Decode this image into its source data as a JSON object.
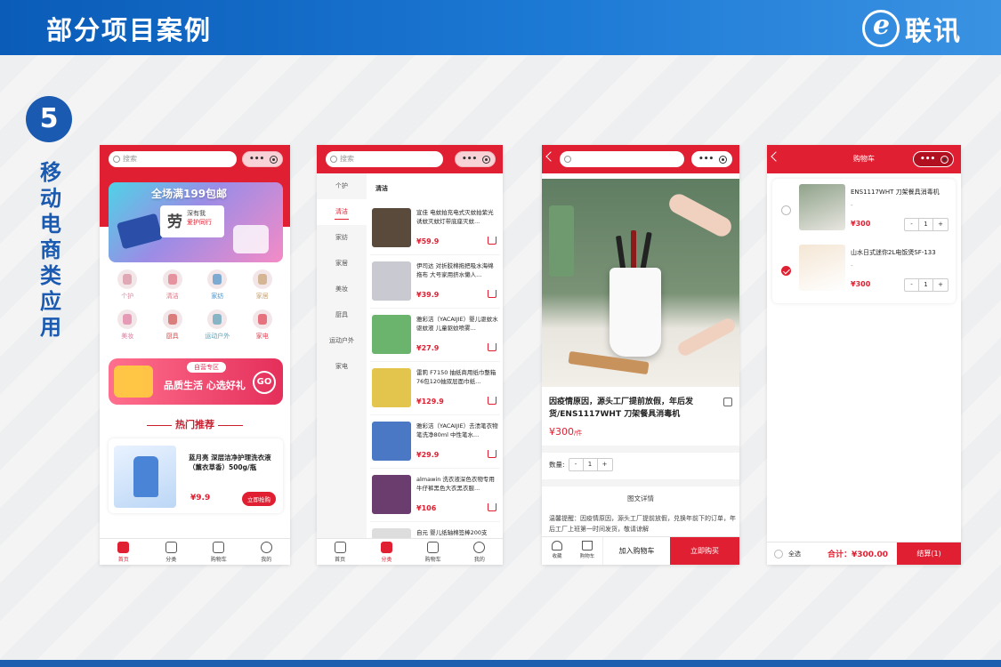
{
  "banner": {
    "title": "部分项目案例",
    "logo_text": "联讯"
  },
  "section": {
    "number": "5",
    "title": "移动电商类应用"
  },
  "colors": {
    "primary_red": "#e02032",
    "brand_blue": "#1a5ab0"
  },
  "phone1": {
    "search_placeholder": "搜索",
    "promo_top": "全场满199包邮",
    "promo_big": "劳",
    "promo_small1": "深有我",
    "promo_small2": "爱护同行",
    "categories": [
      {
        "label": "个护",
        "icon": "personal-care-icon"
      },
      {
        "label": "清洁",
        "icon": "cleaning-icon"
      },
      {
        "label": "家纺",
        "icon": "textile-icon"
      },
      {
        "label": "家居",
        "icon": "home-icon"
      },
      {
        "label": "美妆",
        "icon": "makeup-icon"
      },
      {
        "label": "厨具",
        "icon": "kitchen-icon"
      },
      {
        "label": "运动户外",
        "icon": "sports-icon"
      },
      {
        "label": "家电",
        "icon": "appliance-icon"
      }
    ],
    "promo2_tag": "自营专区",
    "promo2_main": "品质生活 心选好礼",
    "promo2_go": "GO",
    "hot_title": "热门推荐",
    "hot_item": {
      "name": "蓝月亮 深层洁净护理洗衣液（薰衣草香）500g/瓶",
      "price": "¥9.9",
      "button": "立即抢购"
    },
    "tabs": [
      {
        "label": "首页",
        "icon": "home-icon",
        "active": true
      },
      {
        "label": "分类",
        "icon": "category-icon",
        "active": false
      },
      {
        "label": "购物车",
        "icon": "cart-icon",
        "active": false
      },
      {
        "label": "我的",
        "icon": "user-icon",
        "active": false
      }
    ]
  },
  "phone2": {
    "search_placeholder": "搜索",
    "sidebar": [
      "个护",
      "清洁",
      "家纺",
      "家居",
      "美妆",
      "厨具",
      "运动户外",
      "家电"
    ],
    "active_side": "清洁",
    "section_title": "清洁",
    "products": [
      {
        "name": "宣佳 电蚊拍充电式灭蚊拍紫光诱蚊灭蚊灯带底座灭蚊...",
        "price": "¥59.9",
        "thumb_color": "#5a4a3c"
      },
      {
        "name": "伊司达 对折胶棉拖把吸水海绵拖布 大号家用挤水懒人...",
        "price": "¥39.9",
        "thumb_color": "#c9c9d2"
      },
      {
        "name": "雅彩洁（YACAIJIE）婴儿驱蚊水 驱蚊液 儿童驱蚊喷雾...",
        "price": "¥27.9",
        "thumb_color": "#6ab46e"
      },
      {
        "name": "雷莉 F7150 抽纸商用纸巾整箱76包120抽双层面巾纸...",
        "price": "¥129.9",
        "thumb_color": "#e3c54e"
      },
      {
        "name": "雅彩洁（YACAIJIE）去渍笔衣物笔洗净80ml 中性笔水...",
        "price": "¥29.9",
        "thumb_color": "#4a78c4"
      },
      {
        "name": "almawin 洗衣液深色衣物专用牛仔裤黑色大衣黑衣服...",
        "price": "¥106",
        "thumb_color": "#6b3c6e"
      },
      {
        "name": "自元 婴儿纸轴棉签棒200支",
        "price": "",
        "thumb_color": "#dddddd"
      }
    ],
    "tabs": [
      {
        "label": "首页",
        "icon": "home-icon",
        "active": false
      },
      {
        "label": "分类",
        "icon": "category-icon",
        "active": true
      },
      {
        "label": "购物车",
        "icon": "cart-icon",
        "active": false
      },
      {
        "label": "我的",
        "icon": "user-icon",
        "active": false
      }
    ]
  },
  "phone3": {
    "title": "因疫情原因，源头工厂提前放假，年后发货/ENS1117WHT 刀架餐具消毒机",
    "price": "¥300",
    "price_unit": "/件",
    "qty_label": "数量:",
    "qty_minus": "-",
    "qty_value": "1",
    "qty_plus": "+",
    "detail_title": "图文详情",
    "detail_text": "温馨提醒：因疫情原因，源头工厂提前放假，兑换年前下的订单，年后工厂上班第一时间发货，敬请谅解",
    "actions": [
      {
        "label": "收藏",
        "icon": "heart-icon"
      },
      {
        "label": "购物车",
        "icon": "cart-icon"
      }
    ],
    "add_cart": "加入购物车",
    "buy_now": "立即购买"
  },
  "phone4": {
    "title": "购物车",
    "items": [
      {
        "name": "ENS1117WHT 刀架餐具消毒机",
        "sub": "-",
        "price": "¥300",
        "qty": "1",
        "checked": false,
        "thumb_color": "#8fa28a"
      },
      {
        "name": "山水日式迷你2L电饭煲SF-133",
        "sub": "-",
        "price": "¥300",
        "qty": "1",
        "checked": true,
        "thumb_color": "#f4e6d4"
      }
    ],
    "stepper_minus": "-",
    "stepper_plus": "+",
    "all_label": "全选",
    "total": "合计：¥300.00",
    "settle": "结算(1)"
  }
}
